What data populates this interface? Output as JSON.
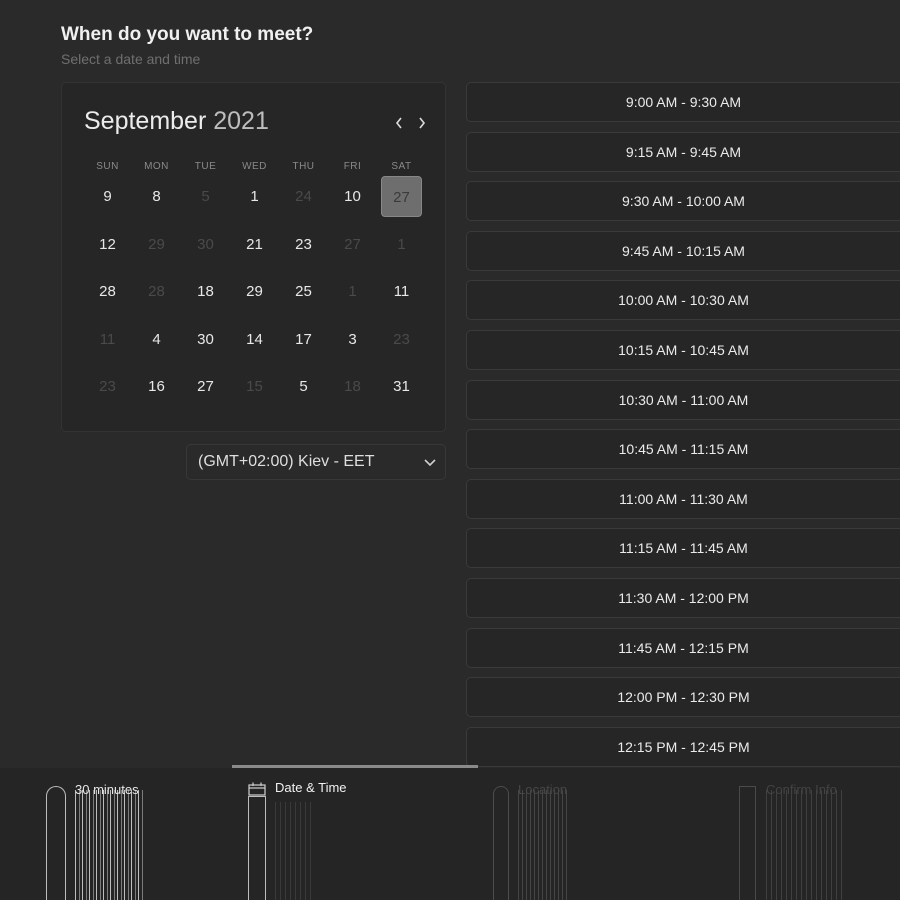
{
  "header": {
    "title": "When do you want to meet?",
    "subtitle": "Select a date and time"
  },
  "calendar": {
    "month": "September",
    "year": "2021",
    "prev_icon": "chevron-left-icon",
    "next_icon": "chevron-right-icon",
    "weekdays": [
      "SUN",
      "MON",
      "TUE",
      "WED",
      "THU",
      "FRI",
      "SAT"
    ],
    "weeks": [
      [
        {
          "d": "9",
          "m": false
        },
        {
          "d": "8",
          "m": false
        },
        {
          "d": "5",
          "m": true
        },
        {
          "d": "1",
          "m": false
        },
        {
          "d": "24",
          "m": true
        },
        {
          "d": "10",
          "m": false
        },
        {
          "d": "27",
          "m": false,
          "sel": true
        }
      ],
      [
        {
          "d": "12",
          "m": false
        },
        {
          "d": "29",
          "m": true
        },
        {
          "d": "30",
          "m": true
        },
        {
          "d": "21",
          "m": false
        },
        {
          "d": "23",
          "m": false
        },
        {
          "d": "27",
          "m": true
        },
        {
          "d": "1",
          "m": true
        }
      ],
      [
        {
          "d": "28",
          "m": false
        },
        {
          "d": "28",
          "m": true
        },
        {
          "d": "18",
          "m": false
        },
        {
          "d": "29",
          "m": false
        },
        {
          "d": "25",
          "m": false
        },
        {
          "d": "1",
          "m": true
        },
        {
          "d": "11",
          "m": false
        }
      ],
      [
        {
          "d": "11",
          "m": true
        },
        {
          "d": "4",
          "m": false
        },
        {
          "d": "30",
          "m": false
        },
        {
          "d": "14",
          "m": false
        },
        {
          "d": "17",
          "m": false
        },
        {
          "d": "3",
          "m": false
        },
        {
          "d": "23",
          "m": true
        }
      ],
      [
        {
          "d": "23",
          "m": true
        },
        {
          "d": "16",
          "m": false
        },
        {
          "d": "27",
          "m": false
        },
        {
          "d": "15",
          "m": true
        },
        {
          "d": "5",
          "m": false
        },
        {
          "d": "18",
          "m": true
        },
        {
          "d": "31",
          "m": false
        }
      ]
    ],
    "selected_color": "#6e6e6e"
  },
  "timezone": {
    "value": "(GMT+02:00) Kiev - EET",
    "icon": "chevron-down-icon"
  },
  "time_slots": [
    "9:00 AM - 9:30 AM",
    "9:15 AM - 9:45 AM",
    "9:30 AM - 10:00 AM",
    "9:45 AM - 10:15 AM",
    "10:00 AM - 10:30 AM",
    "10:15 AM - 10:45 AM",
    "10:30 AM - 11:00 AM",
    "10:45 AM - 11:15 AM",
    "11:00 AM - 11:30 AM",
    "11:15 AM - 11:45 AM",
    "11:30 AM - 12:00 PM",
    "11:45 AM - 12:15 PM",
    "12:00 PM - 12:30 PM",
    "12:15 PM - 12:45 PM"
  ],
  "steps": {
    "duration": "30 minutes",
    "date_time": "Date & Time",
    "location": "Location",
    "confirm": "Confirm Info",
    "date_time_icon": "calendar-icon"
  },
  "colors": {
    "background": "#2a2a2a",
    "panel": "#262626",
    "text": "#ececec",
    "muted": "#4a4a4a"
  }
}
